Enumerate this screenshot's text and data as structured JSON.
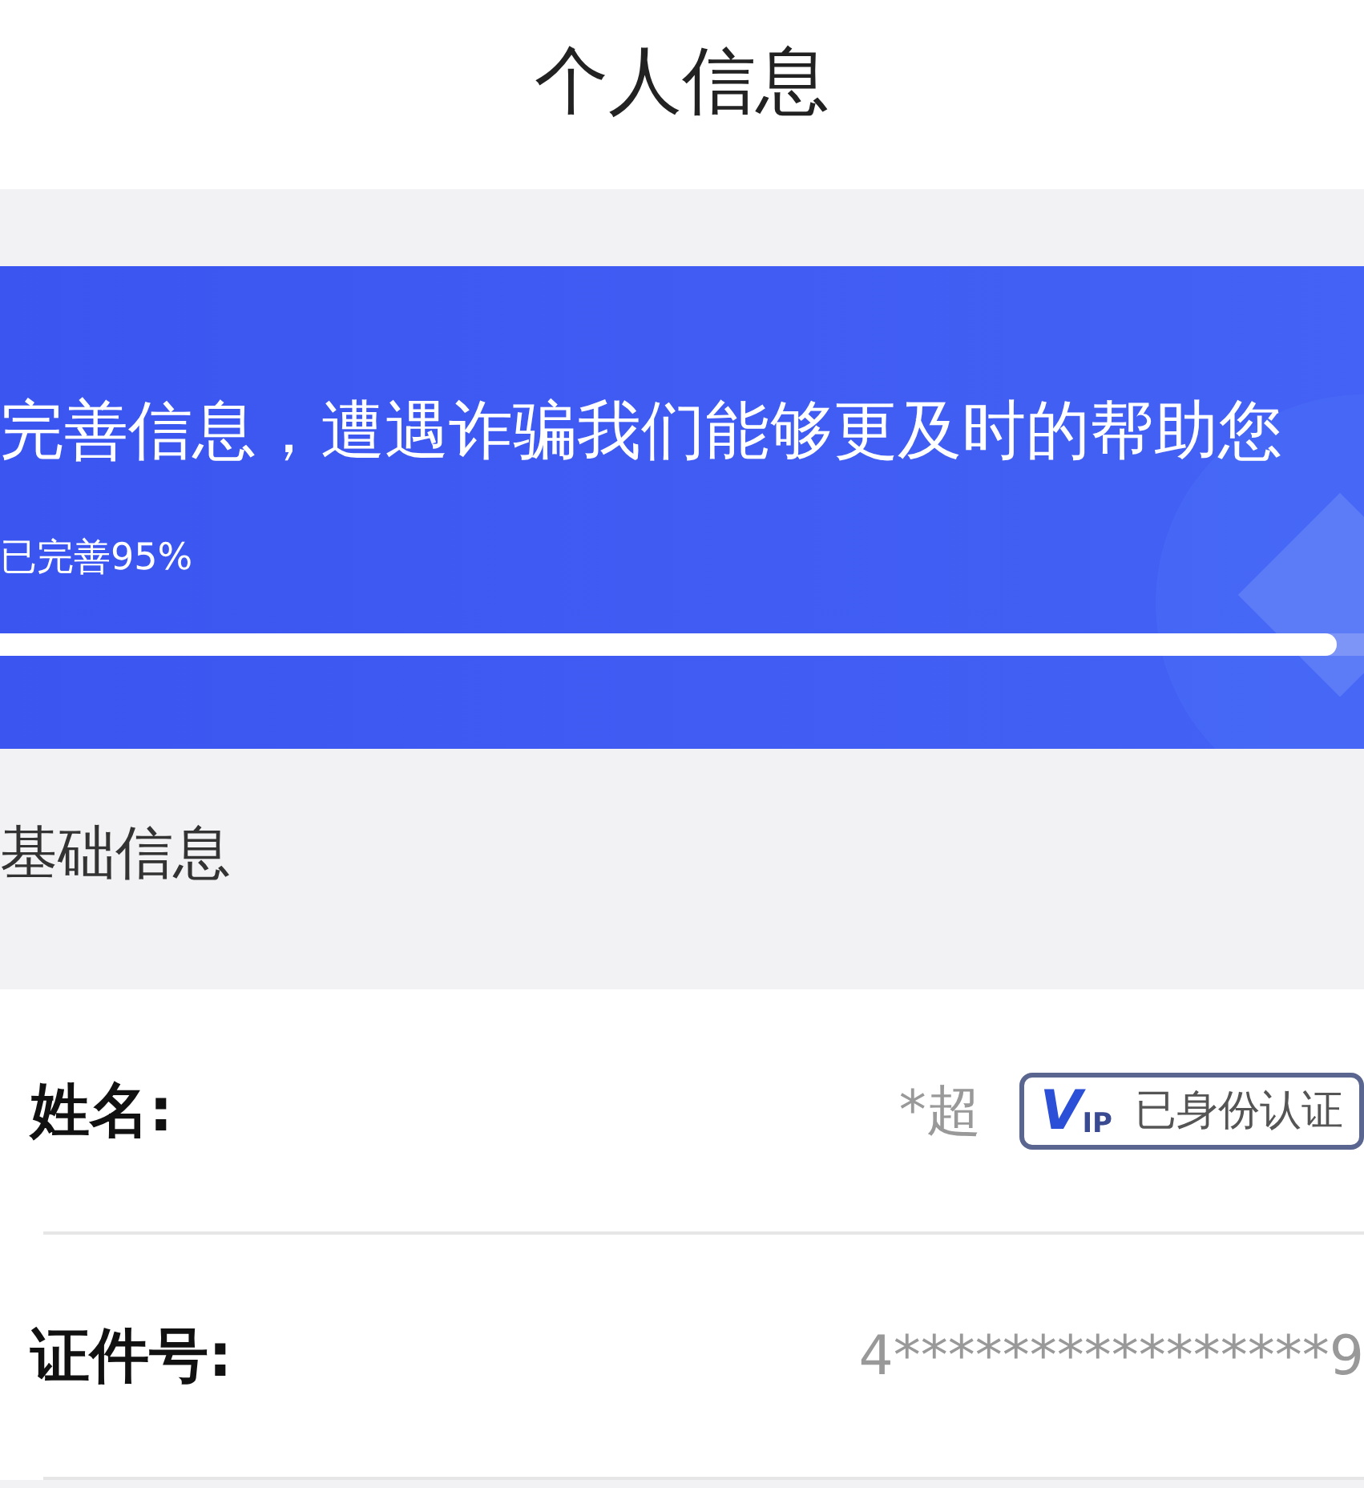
{
  "title": "个人信息",
  "banner": {
    "message": "完善信息，遭遇诈骗我们能够更及时的帮助您",
    "progress_label": "已完善95%",
    "level": 0.98
  },
  "section_title": "基础信息",
  "rows": [
    {
      "kind": "verified",
      "label": "姓名:",
      "value": "*超",
      "badge": {
        "logo_main": "V",
        "logo_sub": "IP",
        "text": "已身份认证"
      }
    },
    {
      "kind": "plain",
      "label": "证件号:",
      "value": "4****************9"
    }
  ]
}
